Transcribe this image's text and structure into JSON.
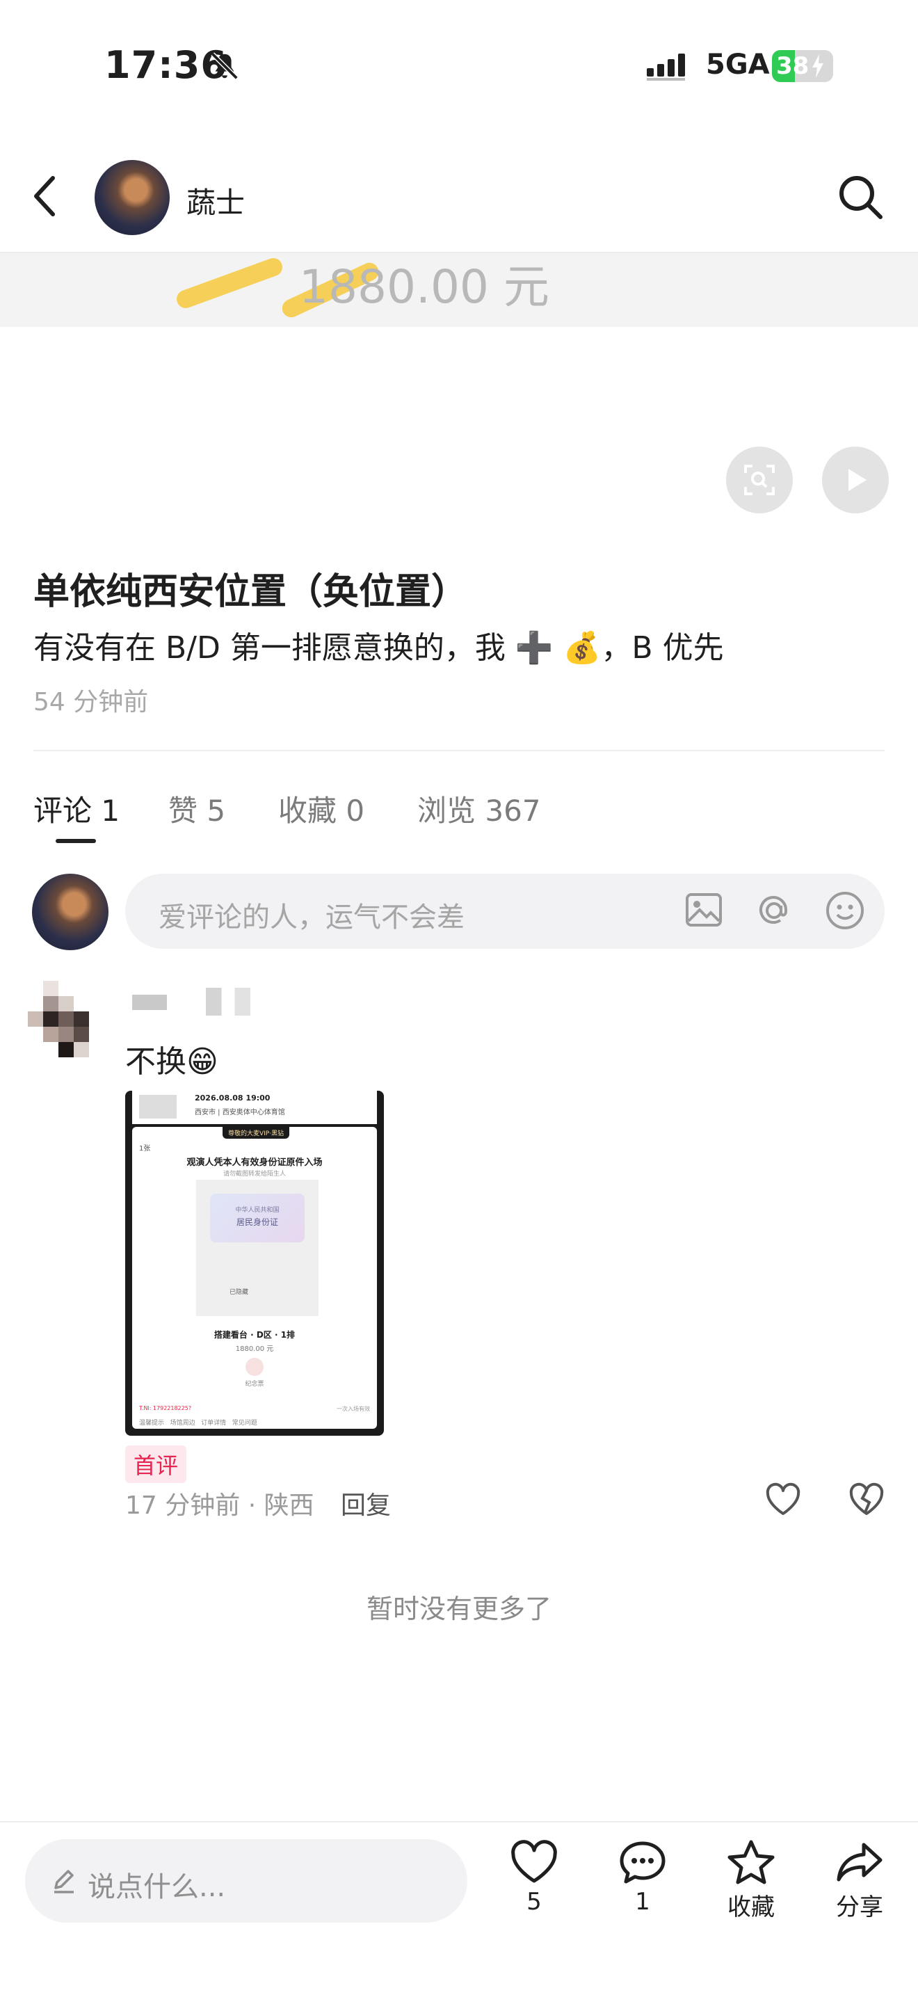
{
  "status_bar": {
    "time": "17:36",
    "network": "5GA",
    "battery": "38",
    "battery_level": 0.38
  },
  "header": {
    "author": "蔬士"
  },
  "image_preview": {
    "price_text": "1880.00 元"
  },
  "post": {
    "title": "单依纯西安位置（奂位置）",
    "body": "有没有在 B/D 第一排愿意换的，我 ➕ 💰，B 优先",
    "time_ago": "54 分钟前"
  },
  "tabs": [
    {
      "label": "评论 1"
    },
    {
      "label": "赞 5"
    },
    {
      "label": "收藏 0"
    },
    {
      "label": "浏览 367"
    }
  ],
  "comment_input": {
    "placeholder": "爱评论的人，运气不会差"
  },
  "comment": {
    "text": "不换😁",
    "badge": "首评",
    "meta": "17 分钟前 · 陕西",
    "reply": "回复",
    "ticket": {
      "datetime": "2026.08.08 19:00",
      "venue": "西安市 | 西安奥体中心体育馆",
      "tag": "尊敬的大麦VIP·黑钻",
      "count": "1张",
      "heading": "观演人凭本人有效身份证原件入场",
      "subheading": "请勿截图转发给陌生人",
      "id_line1": "中华人民共和国",
      "id_line2": "居民身份证",
      "hidden": "已隐藏",
      "seat": "搭建看台 · D区 · 1排",
      "price": "1880.00 元",
      "souvenir": "纪念票",
      "bottom_left": "T.Nl: 1792218225?",
      "bottom_right": "一次入场有效",
      "footer_tabs": "温馨提示   场馆周边   订单详情   常见问题"
    }
  },
  "end_text": "暂时没有更多了",
  "bottom_bar": {
    "input_placeholder": "说点什么...",
    "like_count": "5",
    "comment_count": "1",
    "collect_label": "收藏",
    "share_label": "分享"
  }
}
